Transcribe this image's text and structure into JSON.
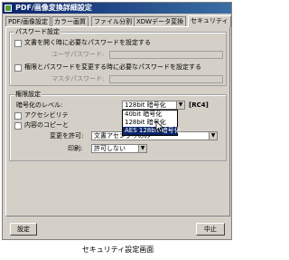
{
  "window": {
    "title": "PDF/画像変換詳細設定"
  },
  "tabs": [
    {
      "label": "PDF/画像設定"
    },
    {
      "label": "カラー画質"
    },
    {
      "label": "ファイル分割"
    },
    {
      "label": "XDWデータ変換"
    },
    {
      "label": "セキュリティ"
    }
  ],
  "password_group": {
    "label": "パスワード設定",
    "open_checkbox_label": "文書を開く時に必要なパスワードを設定する",
    "user_password_label": "ユーザパスワード:",
    "perm_checkbox_label": "権限とパスワードを変更する時に必要なパスワードを設定する",
    "master_password_label": "マスタパスワード:"
  },
  "permission_group": {
    "label": "権限設定",
    "encryption_label": "暗号化のレベル:",
    "encryption_value": "128bit 暗号化",
    "encryption_suffix": "[RC4]",
    "encryption_options": [
      "40bit 暗号化",
      "128bit 暗号化",
      "AES 128bit 暗号化"
    ],
    "accessibility_label": "アクセシビリテ",
    "copy_label": "内容のコピーと",
    "change_label": "変更を許可:",
    "change_value": "文書アセンブリのみ",
    "print_label": "印刷:",
    "print_value": "許可しない"
  },
  "buttons": {
    "settings": "設定",
    "cancel": "中止"
  },
  "caption": "セキュリティ設定画面"
}
